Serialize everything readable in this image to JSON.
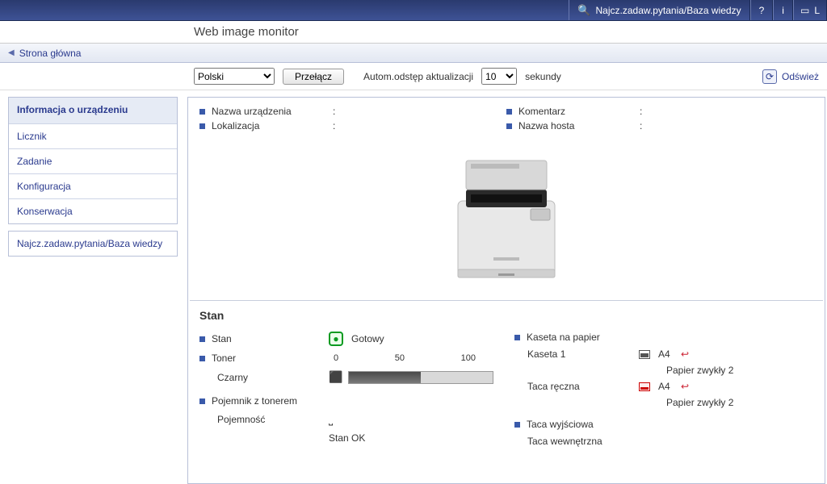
{
  "topbar": {
    "kb_link": "Najcz.zadaw.pytania/Baza wiedzy",
    "help": "?",
    "info": "i",
    "login_prefix": "L"
  },
  "app_title": "Web image monitor",
  "breadcrumb": "Strona główna",
  "controls": {
    "lang_options": [
      "Polski"
    ],
    "lang_selected": "Polski",
    "switch_btn": "Przełącz",
    "auto_label": "Autom.odstęp aktualizacji",
    "interval_selected": "10",
    "seconds_label": "sekundy",
    "refresh_label": "Odśwież"
  },
  "sidebar": {
    "group1": [
      "Informacja o urządzeniu",
      "Licznik",
      "Zadanie",
      "Konfiguracja",
      "Konserwacja"
    ],
    "group2": [
      "Najcz.zadaw.pytania/Baza wiedzy"
    ],
    "active_index": 0
  },
  "device_info": {
    "left": [
      {
        "label": "Nazwa urządzenia",
        "value": ""
      },
      {
        "label": "Lokalizacja",
        "value": ""
      }
    ],
    "right": [
      {
        "label": "Komentarz",
        "value": ""
      },
      {
        "label": "Nazwa hosta",
        "value": ""
      }
    ]
  },
  "status": {
    "heading": "Stan",
    "state_label": "Stan",
    "state_value": "Gotowy",
    "toner_label": "Toner",
    "toner_scale": {
      "min": "0",
      "mid": "50",
      "max": "100"
    },
    "toner_color_label": "Czarny",
    "toner_level_pct": 50,
    "waste_label": "Pojemnik z tonerem",
    "waste_sub_label": "Pojemność",
    "waste_status": "Stan OK",
    "paper_tray_label": "Kaseta na papier",
    "trays": [
      {
        "name": "Kaseta 1",
        "size": "A4",
        "type": "Papier zwykły 2",
        "icon": "full"
      },
      {
        "name": "Taca ręczna",
        "size": "A4",
        "type": "Papier zwykły 2",
        "icon": "red"
      }
    ],
    "output_tray_label": "Taca wyjściowa",
    "output_tray_name": "Taca wewnętrzna"
  }
}
